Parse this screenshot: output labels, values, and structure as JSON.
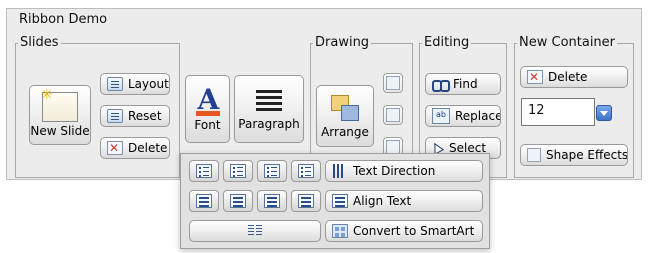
{
  "ribbon": {
    "title": "Ribbon Demo"
  },
  "slides": {
    "legend": "Slides",
    "new_slide": "New Slide",
    "layout": "Layout",
    "reset": "Reset",
    "delete": "Delete"
  },
  "font_group": {
    "font": "Font",
    "paragraph": "Paragraph"
  },
  "drawing": {
    "legend": "Drawing",
    "arrange": "Arrange"
  },
  "editing": {
    "legend": "Editing",
    "find": "Find",
    "replace": "Replace",
    "select": "Select"
  },
  "new_container": {
    "legend": "New Container",
    "delete": "Delete",
    "spinner_value": "12",
    "shape_effects": "Shape Effects"
  },
  "paragraph_popup": {
    "text_direction": "Text Direction",
    "align_text": "Align Text",
    "convert_to_smartart": "Convert to SmartArt"
  },
  "icons": {
    "new_slide": "new-slide-icon",
    "layout": "layout-icon",
    "reset": "reset-icon",
    "delete": "delete-icon",
    "font": "font-icon",
    "paragraph": "paragraph-icon",
    "arrange": "arrange-icon",
    "find": "find-icon",
    "replace": "replace-icon",
    "select": "select-icon",
    "shape_effects": "shape-effects-icon",
    "text_direction": "text-direction-icon",
    "align_text": "align-text-icon",
    "convert_to_smartart": "smartart-icon"
  },
  "colors": {
    "font_blue": "#233f8f",
    "font_underline": "#e8571f",
    "spinner_arrow": "#3f72c7"
  }
}
